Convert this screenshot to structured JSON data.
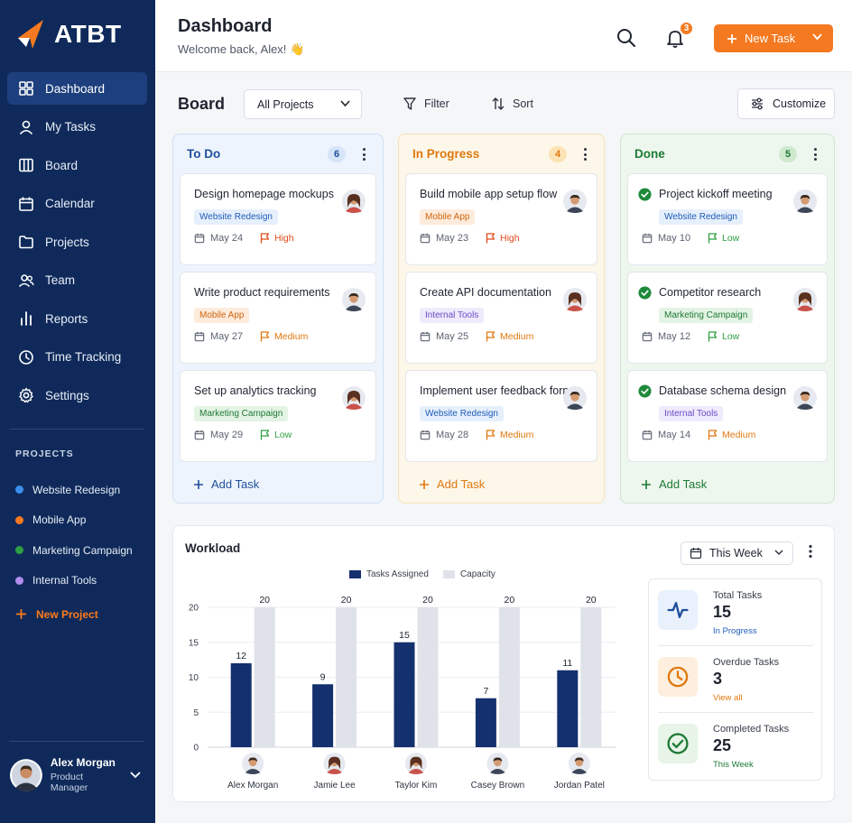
{
  "brand": {
    "name": "ATBT"
  },
  "nav": [
    {
      "label": "Dashboard",
      "icon": "grid-icon",
      "active": true
    },
    {
      "label": "My Tasks",
      "icon": "user-icon"
    },
    {
      "label": "Board",
      "icon": "board-icon"
    },
    {
      "label": "Calendar",
      "icon": "calendar-icon"
    },
    {
      "label": "Projects",
      "icon": "folder-icon"
    },
    {
      "label": "Team",
      "icon": "team-icon"
    },
    {
      "label": "Reports",
      "icon": "bar-chart-icon"
    },
    {
      "label": "Time Tracking",
      "icon": "clock-icon"
    },
    {
      "label": "Settings",
      "icon": "gear-icon"
    }
  ],
  "projects": {
    "heading": "PROJECTS",
    "items": [
      {
        "label": "Website Redesign",
        "color": "#3b8eea"
      },
      {
        "label": "Mobile App",
        "color": "#f47920"
      },
      {
        "label": "Marketing Campaign",
        "color": "#2ea043"
      },
      {
        "label": "Internal Tools",
        "color": "#b38df0"
      }
    ],
    "new_label": "New Project"
  },
  "user": {
    "name": "Alex Morgan",
    "role": "Product Manager"
  },
  "header": {
    "title": "Dashboard",
    "welcome": "Welcome back, Alex! 👋",
    "notification_count": "3",
    "new_task_label": "New Task"
  },
  "toolbar": {
    "board_title": "Board",
    "project_filter": "All Projects",
    "filter_label": "Filter",
    "sort_label": "Sort",
    "customize_label": "Customize"
  },
  "columns": [
    {
      "title": "To Do",
      "count": "6",
      "color": "#1f4f9c",
      "bg": "#eef4fd",
      "border": "#cfdff5",
      "badge_bg": "#d6e4f8",
      "add_label": "Add Task",
      "add_color": "#1f4f9c",
      "cards": [
        {
          "title": "Design homepage mockups",
          "tag": "Website Redesign",
          "tag_type": "blue",
          "date": "May 24",
          "priority": "High",
          "avatar": "woman"
        },
        {
          "title": "Write product requirements",
          "tag": "Mobile App",
          "tag_type": "orange",
          "date": "May 27",
          "priority": "Medium",
          "avatar": "man"
        },
        {
          "title": "Set up analytics tracking",
          "tag": "Marketing Campaign",
          "tag_type": "green",
          "date": "May 29",
          "priority": "Low",
          "avatar": "woman"
        }
      ]
    },
    {
      "title": "In Progress",
      "count": "4",
      "color": "#e0780f",
      "bg": "#fdf7ea",
      "border": "#f4e2b8",
      "badge_bg": "#fbe3b6",
      "add_label": "Add Task",
      "add_color": "#e0780f",
      "cards": [
        {
          "title": "Build mobile app setup flow",
          "tag": "Mobile App",
          "tag_type": "orange",
          "date": "May 23",
          "priority": "High",
          "avatar": "man"
        },
        {
          "title": "Create API documentation",
          "tag": "Internal Tools",
          "tag_type": "purple",
          "date": "May 25",
          "priority": "Medium",
          "avatar": "woman"
        },
        {
          "title": "Implement user feedback form",
          "tag": "Website Redesign",
          "tag_type": "blue",
          "date": "May 28",
          "priority": "Medium",
          "avatar": "man"
        }
      ]
    },
    {
      "title": "Done",
      "count": "5",
      "color": "#1e7a35",
      "bg": "#eef7ee",
      "border": "#cfe6cf",
      "badge_bg": "#cfe9cf",
      "add_label": "Add Task",
      "add_color": "#1e7a35",
      "cards": [
        {
          "title": "Project kickoff meeting",
          "tag": "Website Redesign",
          "tag_type": "blue",
          "date": "May 10",
          "priority": "Low",
          "avatar": "man",
          "done": true
        },
        {
          "title": "Competitor research",
          "tag": "Marketing Campaign",
          "tag_type": "green",
          "date": "May 12",
          "priority": "Low",
          "avatar": "woman",
          "done": true
        },
        {
          "title": "Database schema design",
          "tag": "Internal Tools",
          "tag_type": "purple",
          "date": "May 14",
          "priority": "Medium",
          "avatar": "man",
          "done": true
        }
      ]
    }
  ],
  "workload": {
    "title": "Workload",
    "period": "This Week",
    "stats": [
      {
        "label": "Total Tasks",
        "value": "15",
        "sub": "In Progress",
        "sub_color": "#1f5bb8",
        "icon": "pulse-icon",
        "icon_bg": "#e9f1fc",
        "icon_color": "#1f4f9c"
      },
      {
        "label": "Overdue Tasks",
        "value": "3",
        "sub": "View all",
        "sub_color": "#e0780f",
        "icon": "clock-icon",
        "icon_bg": "#fdeedd",
        "icon_color": "#e0780f"
      },
      {
        "label": "Completed Tasks",
        "value": "25",
        "sub": "This Week",
        "sub_color": "#1e7a35",
        "icon": "check-circle-icon",
        "icon_bg": "#e7f4e7",
        "icon_color": "#1e7a35"
      }
    ]
  },
  "chart_data": {
    "type": "bar",
    "categories": [
      "Alex Morgan",
      "Jamie Lee",
      "Taylor Kim",
      "Casey Brown",
      "Jordan Patel"
    ],
    "series": [
      {
        "name": "Tasks Assigned",
        "values": [
          12,
          9,
          15,
          7,
          11
        ],
        "color": "#15306e"
      },
      {
        "name": "Capacity",
        "values": [
          20,
          20,
          20,
          20,
          20
        ],
        "color": "#dfe2e8"
      }
    ],
    "yticks": [
      0,
      5,
      10,
      15,
      20
    ],
    "ylim": [
      0,
      20
    ],
    "legend": "top-center",
    "grid": true
  }
}
